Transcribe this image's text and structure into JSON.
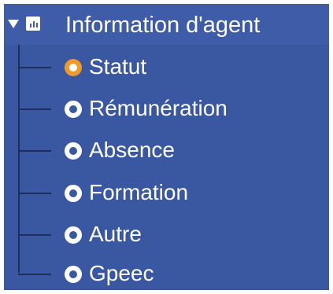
{
  "tree": {
    "header": {
      "title": "Information d'agent",
      "icon": "report-icon",
      "expanded": true
    },
    "items": [
      {
        "label": "Statut",
        "selected": true
      },
      {
        "label": "Rémunération",
        "selected": false
      },
      {
        "label": "Absence",
        "selected": false
      },
      {
        "label": "Formation",
        "selected": false
      },
      {
        "label": "Autre",
        "selected": false
      },
      {
        "label": "Gpeec",
        "selected": false
      }
    ]
  },
  "colors": {
    "panel_bg": "#3a57a2",
    "selected_accent": "#f09a2a",
    "text": "#ffffff",
    "tree_lines": "#1f2f5a"
  }
}
